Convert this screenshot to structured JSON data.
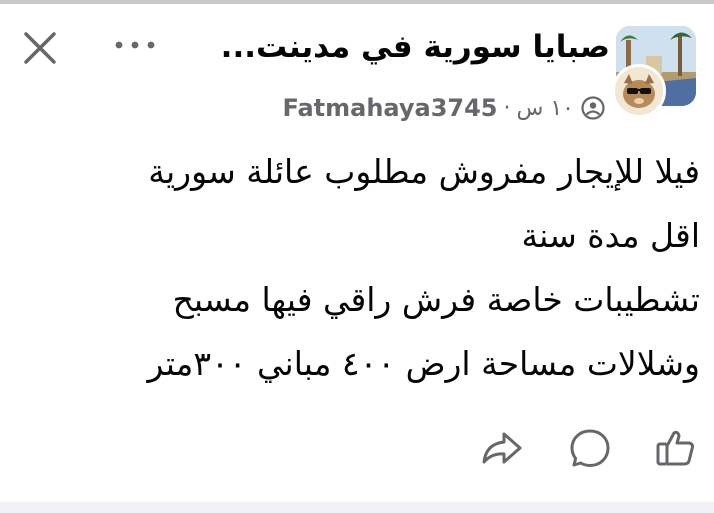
{
  "header": {
    "group_name": "صبايا سورية في مدينت...",
    "author": "Fatmahaya3745",
    "separator": "·",
    "time": "١٠ س",
    "privacy_icon": "globe-icon",
    "close_icon": "close-icon",
    "more_icon": "more-options-icon"
  },
  "post": {
    "lines": [
      "فيلا للإيجار مفروش مطلوب عائلة سورية",
      "اقل مدة سنة",
      "تشطيبات خاصة فرش راقي فيها  مسبح",
      "وشلالات  مساحة ارض ٤٠٠ مباني ٣٠٠متر"
    ]
  },
  "actions": {
    "share_icon": "share-icon",
    "comment_icon": "comment-icon",
    "like_icon": "like-icon"
  },
  "colors": {
    "text": "#050505",
    "meta": "#65676b",
    "icon": "#65676b",
    "divider": "#f0f2f5"
  }
}
